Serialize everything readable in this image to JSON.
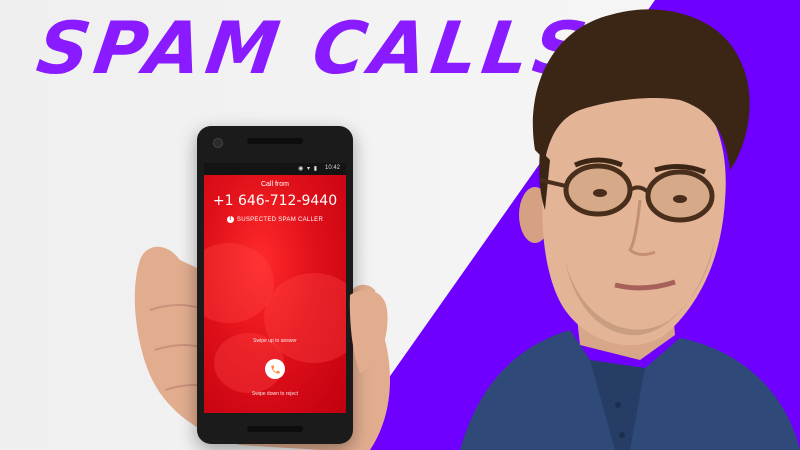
{
  "headline": {
    "text": "SPAM CALLS"
  },
  "phone": {
    "status_time": "10:42",
    "call_from": "Call from",
    "number": "+1 646-712-9440",
    "spam_label": "SUSPECTED SPAM CALLER",
    "swipe_up": "Swipe up to answer",
    "swipe_down": "Swipe down to reject"
  },
  "colors": {
    "accent_purple": "#6f00ff",
    "headline_purple": "#8a1aff",
    "screen_red": "#e0101a",
    "background_light": "#f2f2f2"
  }
}
